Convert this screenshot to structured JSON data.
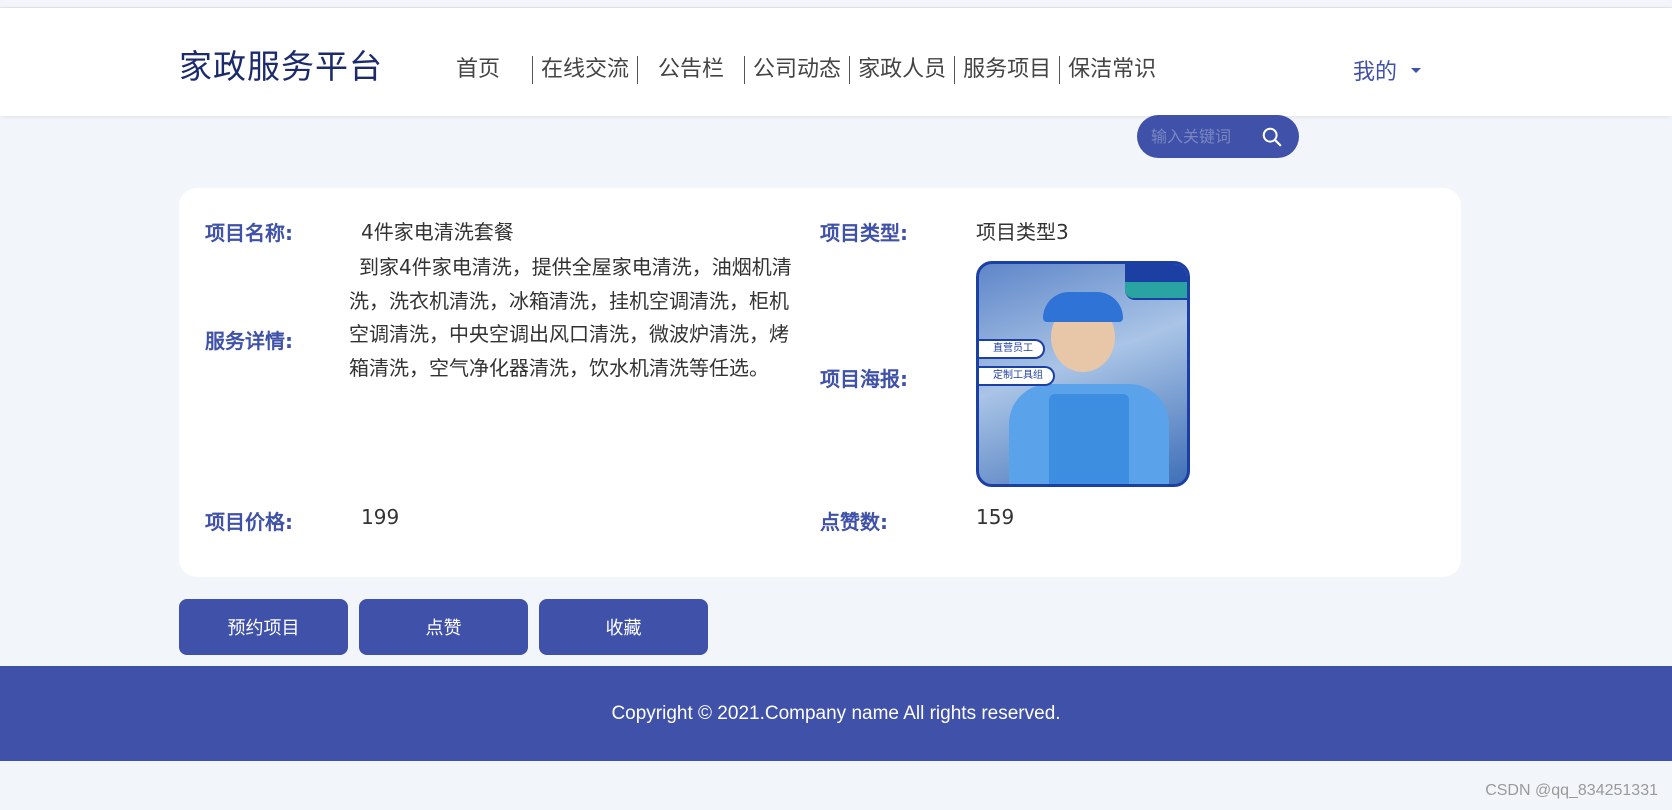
{
  "header": {
    "brand": "家政服务平台",
    "nav": [
      "首页",
      "在线交流",
      "公告栏",
      "公司动态",
      "家政人员",
      "服务项目",
      "保洁常识"
    ],
    "user_menu": "我的"
  },
  "search": {
    "placeholder": "输入关键词"
  },
  "detail": {
    "name_label": "项目名称:",
    "name_value": "4件家电清洗套餐",
    "type_label": "项目类型:",
    "type_value": "项目类型3",
    "service_label": "服务详情:",
    "service_value": "到家4件家电清洗，提供全屋家电清洗，油烟机清洗，洗衣机清洗，冰箱清洗，挂机空调清洗，柜机空调清洗，中央空调出风口清洗，微波炉清洗，烤箱清洗，空气净化器清洗，饮水机清洗等任选。",
    "poster_label": "项目海报:",
    "poster_tags": [
      "直营员工",
      "定制工具组"
    ],
    "price_label": "项目价格:",
    "price_value": "199",
    "likes_label": "点赞数:",
    "likes_value": "159"
  },
  "actions": {
    "reserve": "预约项目",
    "like": "点赞",
    "favorite": "收藏"
  },
  "footer": {
    "copyright": "Copyright © 2021.Company name All rights reserved."
  },
  "watermark": "CSDN @qq_834251331",
  "colors": {
    "primary": "#3f51a8",
    "background": "#f2f5fa",
    "brand_text": "#1b2a6b"
  }
}
